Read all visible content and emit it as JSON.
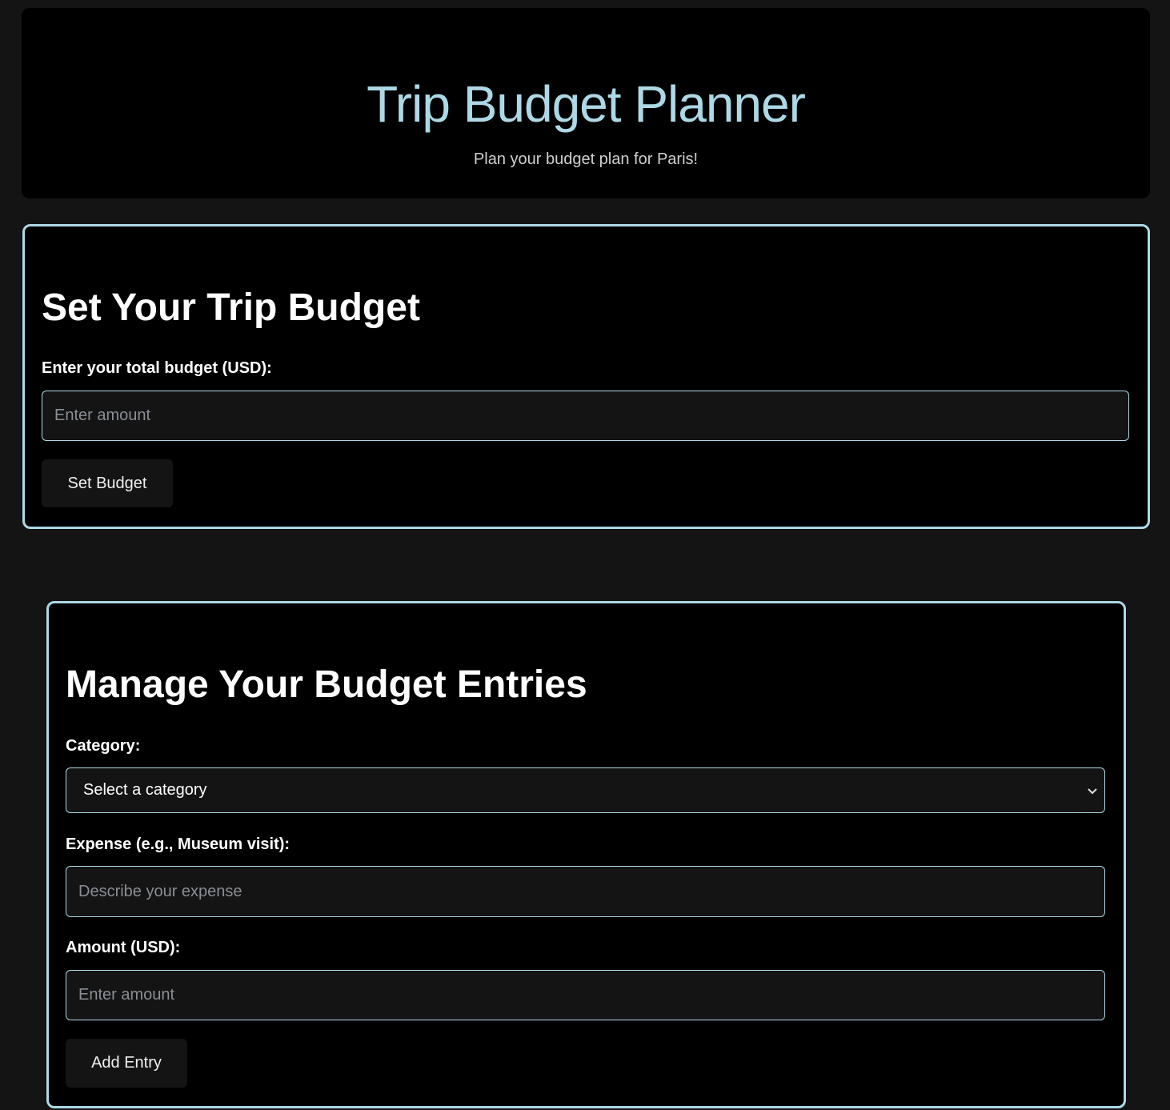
{
  "header": {
    "title": "Trip Budget Planner",
    "subtitle": "Plan your budget plan for Paris!"
  },
  "budget_section": {
    "heading": "Set Your Trip Budget",
    "label": "Enter your total budget (USD):",
    "input_placeholder": "Enter amount",
    "input_value": "",
    "button": "Set Budget"
  },
  "entries_section": {
    "heading": "Manage Your Budget Entries",
    "category_label": "Category:",
    "category_selected": "Select a category",
    "expense_label": "Expense (e.g., Museum visit):",
    "expense_placeholder": "Describe your expense",
    "amount_label": "Amount (USD):",
    "amount_placeholder": "Enter amount",
    "button": "Add Entry"
  },
  "colors": {
    "accent": "#add8e6",
    "background": "#141414",
    "card": "#000000"
  }
}
